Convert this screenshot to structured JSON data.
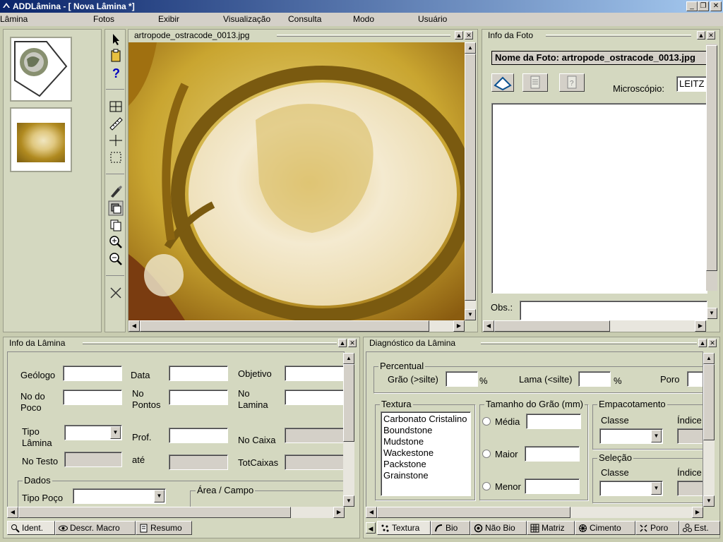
{
  "window": {
    "title": "ADDLâmina - [ Nova Lâmina *]"
  },
  "menu": [
    "Lâmina",
    "Fotos",
    "Exibir",
    "Visualização",
    "Consulta",
    "Modo",
    "Usuário"
  ],
  "image_panel": {
    "title": "artropode_ostracode_0013.jpg"
  },
  "info_foto": {
    "title": "Info da Foto",
    "nome_label": "Nome da Foto: artropode_ostracode_0013.jpg",
    "microscopio_label": "Microscópio:",
    "microscopio_value": "LEITZ",
    "obs_label": "Obs.:"
  },
  "info_lamina": {
    "title": "Info da Lâmina",
    "geologo": "Geólogo",
    "data": "Data",
    "objetivo": "Objetivo",
    "no_do_poco": [
      "No do",
      "Poco"
    ],
    "no_pontos": [
      "No",
      "Pontos"
    ],
    "no_lamina": [
      "No",
      "Lamina"
    ],
    "tipo_lamina": [
      "Tipo",
      "Lâmina"
    ],
    "prof": "Prof.",
    "no_caixa": "No Caixa",
    "no_testo": "No Testo",
    "ate": "até",
    "totcaixas": "TotCaixas",
    "dados": "Dados",
    "tipo_poco": "Tipo Poço",
    "area_campo": "Área / Campo",
    "tabs": [
      "Ident.",
      "Descr. Macro",
      "Resumo"
    ]
  },
  "diagnostico": {
    "title": "Diagnóstico da Lâmina",
    "percentual": "Percentual",
    "grao": "Grão (>silte)",
    "lama": "Lama (<silte)",
    "poro": "Poro",
    "pct": "%",
    "textura": "Textura",
    "textura_items": [
      "Carbonato Cristalino",
      "Boundstone",
      "Mudstone",
      "Wackestone",
      "Packstone",
      "Grainstone"
    ],
    "tamanho": "Tamanho do Grão (mm)",
    "media": "Média",
    "maior": "Maior",
    "menor": "Menor",
    "empacotamento": "Empacotamento",
    "classe": "Classe",
    "indice": "Índice",
    "selecao": "Seleção",
    "tabs": [
      "Textura",
      "Bio",
      "Não Bio",
      "Matriz",
      "Cimento",
      "Poro",
      "Est."
    ]
  }
}
